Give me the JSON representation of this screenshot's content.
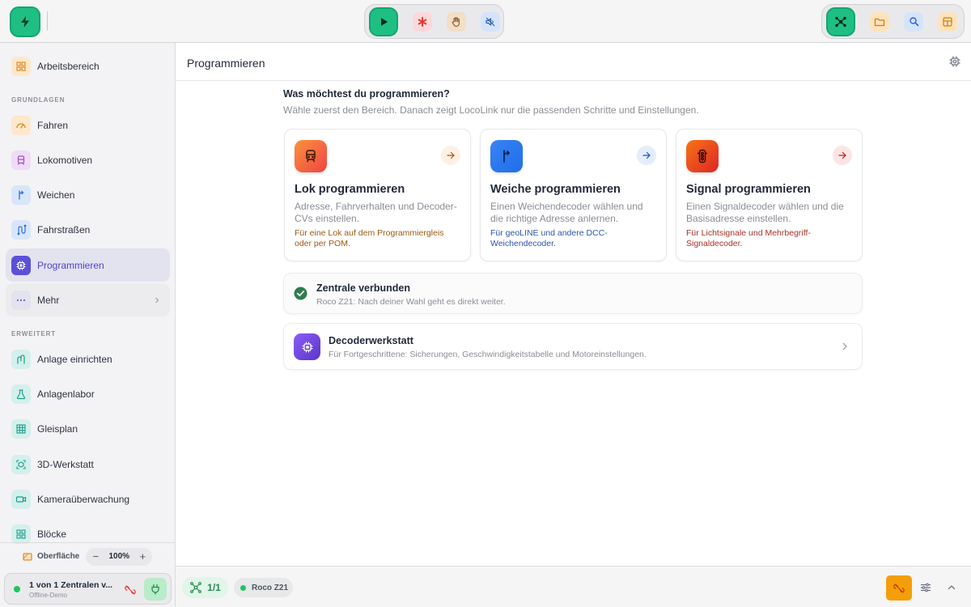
{
  "colors": {
    "accent_green": "#1fbf84",
    "accent_indigo": "#4a43c9",
    "lok_orange": "#f97316",
    "weiche_blue": "#3b82f6",
    "signal_red": "#ef4444",
    "workshop_purple": "#7c3aed",
    "status_green": "#22c55e"
  },
  "topbar": {
    "app_icon": "lightning-icon",
    "center_buttons": [
      "play-icon",
      "asterisk-icon",
      "hand-stop-icon",
      "speaker-mute-icon"
    ],
    "right_buttons": [
      "network-hub-icon",
      "folder-icon",
      "search-icon",
      "layout-icon"
    ]
  },
  "sidebar": {
    "workspace": "Arbeitsbereich",
    "section_basics": "GRUNDLAGEN",
    "items_basic": [
      "Fahren",
      "Lokomotiven",
      "Weichen",
      "Fahrstraßen",
      "Programmieren",
      "Mehr"
    ],
    "section_extended": "ERWEITERT",
    "items_extended": [
      "Anlage einrichten",
      "Anlagenlabor",
      "Gleisplan",
      "3D-Werkstatt",
      "Kameraüberwachung",
      "Blöcke"
    ],
    "active_item": "Programmieren",
    "zoom": {
      "label": "Oberfläche",
      "value": "100%",
      "minus": "−",
      "plus": "+"
    },
    "central": {
      "title": "1 von 1 Zentralen v...",
      "subtitle": "Offline-Demo"
    }
  },
  "main": {
    "title": "Programmieren",
    "question": "Was möchtest du programmieren?",
    "question_sub": "Wähle zuerst den Bereich. Danach zeigt LocoLink nur die passenden Schritte und Einstellungen.",
    "cards": [
      {
        "title": "Lok programmieren",
        "desc": "Adresse, Fahrverhalten und Decoder-CVs einstellen.",
        "note": "Für eine Lok auf dem Programmiergleis oder per POM.",
        "icon": "train-icon"
      },
      {
        "title": "Weiche programmieren",
        "desc": "Einen Weichendecoder wählen und die richtige Adresse anlernen.",
        "note": "Für geoLINE und andere DCC-Weichendecoder.",
        "icon": "switch-icon"
      },
      {
        "title": "Signal programmieren",
        "desc": "Einen Signaldecoder wählen und die Basisadresse einstellen.",
        "note": "Für Lichtsignale und Mehrbegriff-Signaldecoder.",
        "icon": "traffic-light-icon"
      }
    ],
    "status": {
      "title": "Zentrale verbunden",
      "subtitle": "Roco Z21: Nach deiner Wahl geht es direkt weiter."
    },
    "workshop": {
      "title": "Decoderwerkstatt",
      "subtitle": "Für Fortgeschrittene: Sicherungen, Geschwindigkeitstabelle und Motoreinstellungen."
    }
  },
  "bottombar": {
    "network_count": "1/1",
    "central_name": "Roco Z21"
  }
}
